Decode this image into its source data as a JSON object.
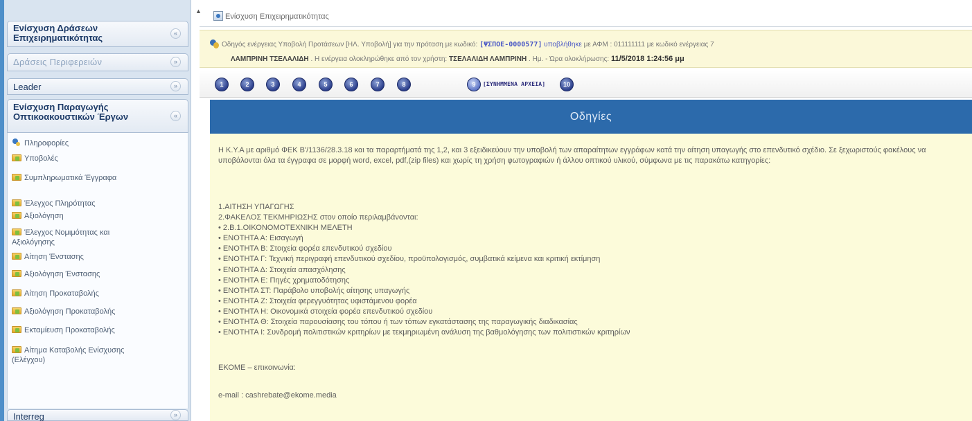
{
  "sidebar": {
    "sections": [
      {
        "title": "Ενίσχυση Δράσεων Επιχειρηματικότητας",
        "toggle": "«"
      },
      {
        "title": "Δράσεις Περιφερειών",
        "toggle": "»"
      },
      {
        "title": "Leader",
        "toggle": "»"
      },
      {
        "title": "Ενίσχυση Παραγωγής Οπτικοακουστικών Έργων",
        "toggle": "«"
      }
    ],
    "items": [
      "Πληροφορίες",
      "Υποβολές",
      "Συμπληρωματικά Έγγραφα",
      "Έλεγχος Πληρότητας",
      "Αξιολόγηση",
      "Έλεγχος Νομιμότητας και Αξιολόγησης",
      "Αίτηση Ένστασης",
      "Αξιολόγηση Ένστασης",
      "Αίτηση Προκαταβολής",
      "Αξιολόγηση Προκαταβολής",
      "Εκταμίευση Προκαταβολής",
      "Αίτημα Καταβολής Ενίσχυσης (Ελέγχου)"
    ],
    "bottom_section": {
      "title": "Interreg",
      "toggle": "»"
    }
  },
  "titlebar": {
    "title": "Ενίσχυση Επιχειρηματικότητας"
  },
  "infobar": {
    "line1_prefix": "Οδηγός ενέργειας Υποβολή Προτάσεων [ΗΛ. Υποβολή] για την πρόταση με κωδικό:",
    "code": "[ΨΣΠΟΕ-0000577]",
    "status": "υποβλήθηκε",
    "line1_suffix": "με ΑΦΜ : 011111111 με κωδικό ενέργειας 7",
    "user_name": "ΛΑΜΠΡΙΝΗ ΤΣΕΛΑΛΙΔΗ",
    "line2_mid": ". Η ενέργεια ολοκληρώθηκε από τον χρήστη:",
    "user_name2": "ΤΣΕΛΑΛΙΔΗ ΛΑΜΠΡΙΝΗ",
    "line2_date_label": ". Ημ. - Ώρα ολοκλήρωσης:",
    "date": "11/5/2018 1:24:56 μμ"
  },
  "steps": {
    "numbers": [
      "1",
      "2",
      "3",
      "4",
      "5",
      "6",
      "7",
      "8",
      "9",
      "10"
    ],
    "active_label": "[ΣΥΝΗΜΜΕΝΑ ΑΡΧΕΙΑ]"
  },
  "content": {
    "header": "Οδηγίες",
    "paragraph": "Η Κ.Υ.Α με αριθμό ΦΕΚ Β'/1136/28.3.18 και τα παραρτήματά της 1,2, και 3 εξειδικεύουν την υποβολή των απαραίτητων εγγράφων κατά την αίτηση υπαγωγής στο επενδυτικό σχέδιο. Σε ξεχωριστούς φακέλους να υποβάλονται όλα τα έγγραφα σε μορφή word, excel, pdf,(zip files) και χωρίς τη χρήση φωτογραφιών ή άλλου οπτικού υλικού, σύμφωνα με τις παρακάτω κατηγορίες:",
    "list": [
      "1.ΑΙΤΗΣΗ ΥΠΑΓΩΓΗΣ",
      "2.ΦΑΚΕΛΟΣ ΤΕΚΜΗΡΙΩΣΗΣ στον οποίο περιλαμβάνονται:",
      "• 2.Β.1.ΟΙΚΟΝΟΜΟΤΕΧΝΙΚΗ ΜΕΛΕΤΗ",
      "• ΕΝΟΤΗΤΑ Α: Εισαγωγή",
      "• ΕΝΟΤΗΤΑ Β: Στοιχεία φορέα επενδυτικού σχεδίου",
      "• ΕΝΟΤΗΤΑ Γ: Τεχνική περιγραφή επενδυτικού σχεδίου, προϋπολογισμός, συμβατικά κείμενα και κριτική εκτίμηση",
      "• ΕΝΟΤΗΤΑ Δ: Στοιχεία απασχόλησης",
      "• ΕΝΟΤΗΤΑ Ε: Πηγές χρηματοδότησης",
      "• ΕΝΟΤΗΤΑ ΣΤ: Παράβολο υποβολής αίτησης υπαγωγής",
      "• ΕΝΟΤΗΤΑ Ζ: Στοιχεία φερεγγυότητας υφιστάμενου φορέα",
      "• ΕΝΟΤΗΤΑ Η: Οικονομικά στοιχεία φορέα επενδυτικού σχεδίου",
      "• ΕΝΟΤΗΤΑ Θ: Στοιχεία παρουσίασης του τόπου ή των τόπων εγκατάστασης της παραγωγικής διαδικασίας",
      "• ΕΝΟΤΗΤΑ Ι: Συνδρομή πολιτιστικών κριτηρίων με τεκμηριωμένη ανάλυση της βαθμολόγησης των πολιτιστικών κριτηρίων"
    ],
    "contact": "ΕΚΟΜΕ – επικοινωνία:",
    "email": "e-mail : cashrebate@ekome.media"
  }
}
